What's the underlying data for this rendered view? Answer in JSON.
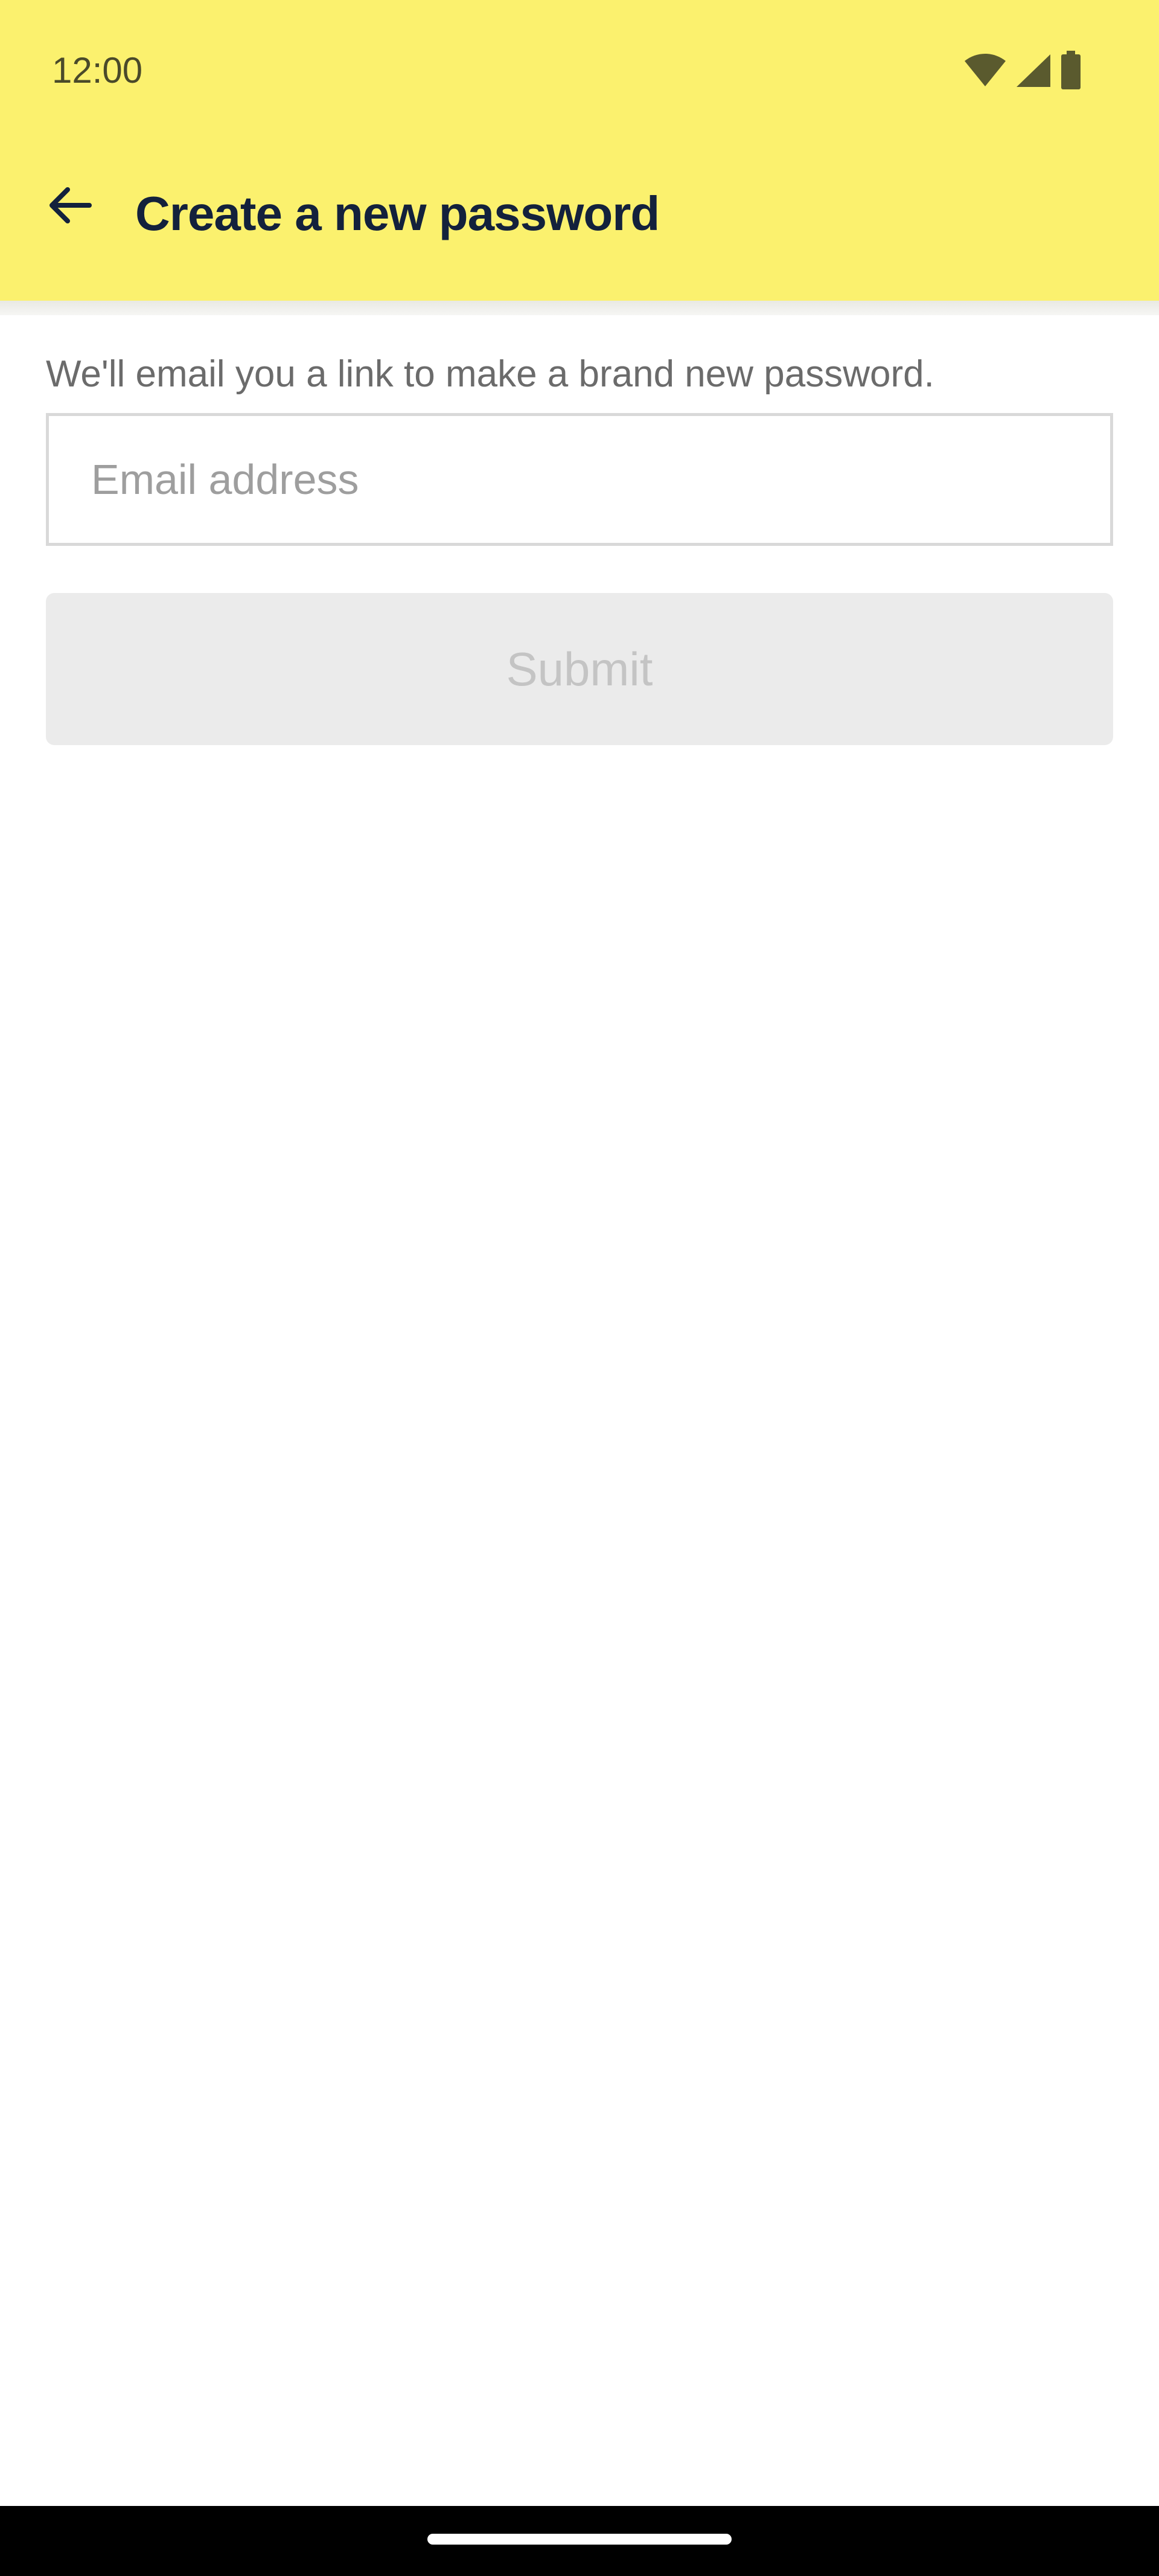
{
  "status_bar": {
    "time": "12:00",
    "icons": [
      "wifi-icon",
      "cellular-signal-icon",
      "battery-icon"
    ]
  },
  "app_bar": {
    "back_icon": "arrow-left-icon",
    "title": "Create a new password"
  },
  "form": {
    "description": "We'll email you a link to make a brand new password.",
    "email": {
      "value": "",
      "placeholder": "Email address"
    },
    "submit_label": "Submit",
    "submit_enabled": false
  },
  "colors": {
    "app_bar_background": "#fbf16e",
    "title_text": "#13213c",
    "disabled_button_background": "#ebebeb",
    "disabled_button_text": "#c4c4c4"
  }
}
